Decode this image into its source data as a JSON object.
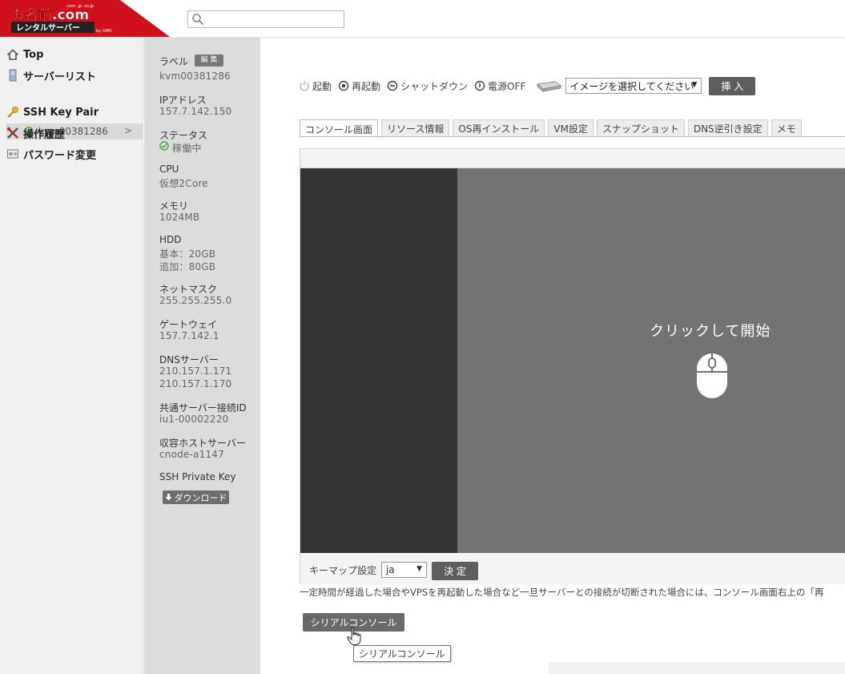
{
  "header": {
    "logo_top": "お名前.com",
    "logo_bottom": "レンタルサーバー",
    "logo_sub": "by GMO",
    "logo_small": ".com .jp .co.jp",
    "search_icon": "search-icon",
    "brand_red": "#d0101b"
  },
  "nav": {
    "items": [
      {
        "label": "Top",
        "icon": "home-icon"
      },
      {
        "label": "サーバーリスト",
        "icon": "server-icon"
      },
      {
        "label": "SSH Key Pair",
        "icon": "key-icon"
      },
      {
        "label": "操作履歴",
        "icon": "tools-icon"
      },
      {
        "label": "パスワード変更",
        "icon": "password-icon"
      }
    ],
    "server_sub": {
      "label": "kvm00381286",
      "status_icon": "check-circle-icon",
      "chevron": ">"
    }
  },
  "info": {
    "label_title": "ラベル",
    "edit_badge": "編 集",
    "label_value": "kvm00381286",
    "ip_title": "IPアドレス",
    "ip_value": "157.7.142.150",
    "status_title": "ステータス",
    "status_value": "稼働中",
    "cpu_title": "CPU",
    "cpu_value": "仮想2Core",
    "memory_title": "メモリ",
    "memory_value": "1024MB",
    "hdd_title": "HDD",
    "hdd_basic": "基本：20GB",
    "hdd_extra": "追加：80GB",
    "netmask_title": "ネットマスク",
    "netmask_value": "255.255.255.0",
    "gateway_title": "ゲートウェイ",
    "gateway_value": "157.7.142.1",
    "dns_title": "DNSサーバー",
    "dns_value_1": "210.157.1.171",
    "dns_value_2": "210.157.1.170",
    "shared_title": "共通サーバー接続ID",
    "shared_value": "iu1-00002220",
    "host_title": "収容ホストサーバー",
    "host_value": "cnode-a1147",
    "ssh_title": "SSH Private Key",
    "download_label": "ダウンロード",
    "status_color": "#3aaa35"
  },
  "power": {
    "start": "起動",
    "restart": "再起動",
    "shutdown": "シャットダウン",
    "power_off": "電源OFF",
    "image_select": "イメージを選択してください",
    "insert": "挿 入"
  },
  "tabs": [
    {
      "label": "コンソール画面",
      "active": true
    },
    {
      "label": "リソース情報",
      "active": false
    },
    {
      "label": "OS再インストール",
      "active": false
    },
    {
      "label": "VM設定",
      "active": false
    },
    {
      "label": "スナップショット",
      "active": false
    },
    {
      "label": "DNS逆引き設定",
      "active": false
    },
    {
      "label": "メモ",
      "active": false
    }
  ],
  "console": {
    "click_to_start": "クリックして開始",
    "keymap_label": "キーマップ設定",
    "keymap_value": "ja",
    "decide": "決 定"
  },
  "notice": "一定時間が経過した場合やVPSを再起動した場合など一旦サーバーとの接続が切断された場合には、コンソール画面右上の「再",
  "serial_console": "シリアルコンソール",
  "tooltip": "シリアルコンソール"
}
